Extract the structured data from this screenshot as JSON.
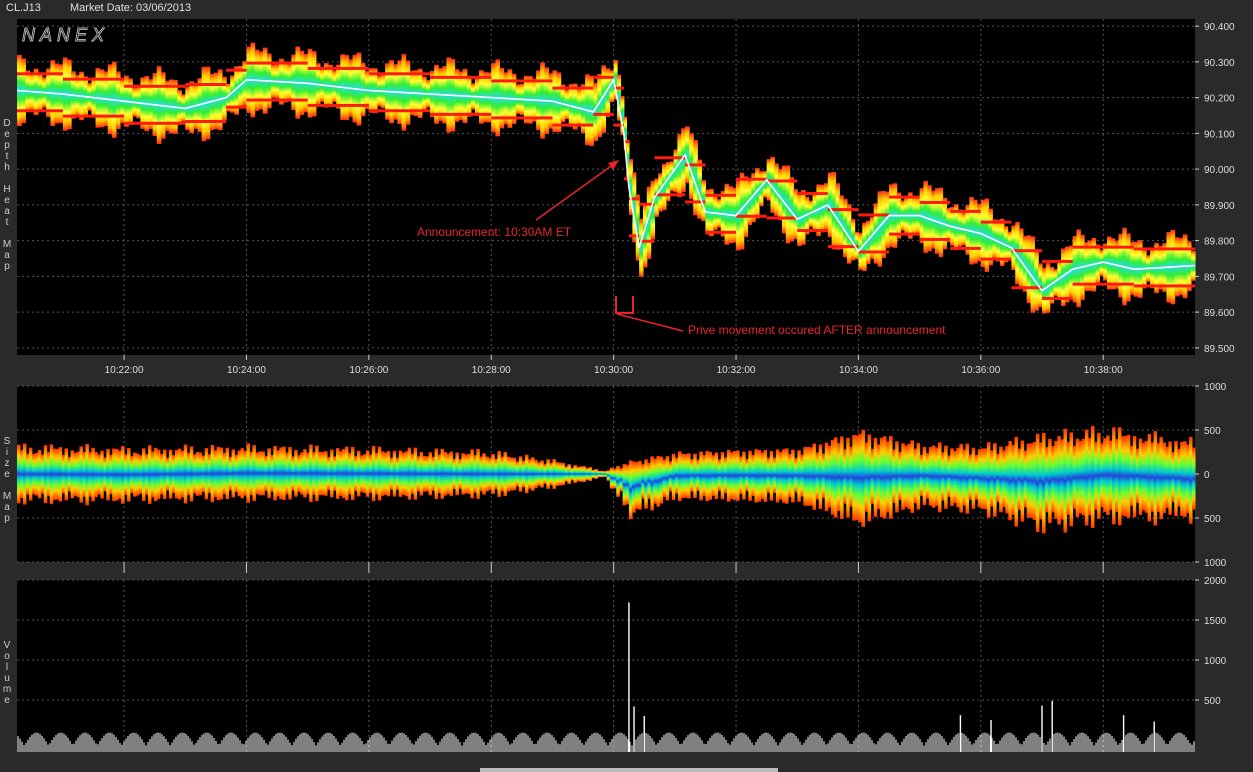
{
  "header": {
    "symbol": "CL.J13",
    "market_date": "Market Date: 03/06/2013"
  },
  "logo": {
    "text": "NANEX"
  },
  "side_labels": {
    "depth": "Depth Heat Map",
    "size": "Size Map",
    "volume": "Volume"
  },
  "annotations": {
    "announcement": "Announcement: 10:30AM ET",
    "movement": "Prive movement occured AFTER announcement"
  },
  "colors": {
    "annotation": "#e8262a",
    "grid": "#555555",
    "background": "#000000",
    "frame": "#2a2a2a"
  },
  "chart_data": [
    {
      "type": "heatmap",
      "name": "Depth Heat Map",
      "x_tick_labels": [
        "10:22:00",
        "10:24:00",
        "10:26:00",
        "10:28:00",
        "10:30:00",
        "10:32:00",
        "10:34:00",
        "10:36:00",
        "10:38:00"
      ],
      "xlim": [
        "10:20:15",
        "10:39:30"
      ],
      "y_tick_labels": [
        "90.400",
        "90.300",
        "90.200",
        "90.100",
        "90.000",
        "89.900",
        "89.800",
        "89.700",
        "89.600",
        "89.500"
      ],
      "y_ticks": [
        90.4,
        90.3,
        90.2,
        90.1,
        90.0,
        89.9,
        89.8,
        89.7,
        89.6,
        89.5
      ],
      "ylim": [
        89.48,
        90.42
      ],
      "grid": true,
      "price_path": [
        {
          "t": "10:20:15",
          "p": 90.22
        },
        {
          "t": "10:21:00",
          "p": 90.21
        },
        {
          "t": "10:22:00",
          "p": 90.19
        },
        {
          "t": "10:23:00",
          "p": 90.17
        },
        {
          "t": "10:23:40",
          "p": 90.2
        },
        {
          "t": "10:24:00",
          "p": 90.25
        },
        {
          "t": "10:25:00",
          "p": 90.24
        },
        {
          "t": "10:26:00",
          "p": 90.22
        },
        {
          "t": "10:27:00",
          "p": 90.21
        },
        {
          "t": "10:28:00",
          "p": 90.2
        },
        {
          "t": "10:29:00",
          "p": 90.19
        },
        {
          "t": "10:29:40",
          "p": 90.16
        },
        {
          "t": "10:30:00",
          "p": 90.25
        },
        {
          "t": "10:30:10",
          "p": 90.1
        },
        {
          "t": "10:30:15",
          "p": 89.95
        },
        {
          "t": "10:30:25",
          "p": 89.78
        },
        {
          "t": "10:30:40",
          "p": 89.92
        },
        {
          "t": "10:31:10",
          "p": 90.04
        },
        {
          "t": "10:31:30",
          "p": 89.88
        },
        {
          "t": "10:32:00",
          "p": 89.87
        },
        {
          "t": "10:32:30",
          "p": 89.97
        },
        {
          "t": "10:33:00",
          "p": 89.86
        },
        {
          "t": "10:33:30",
          "p": 89.9
        },
        {
          "t": "10:34:00",
          "p": 89.77
        },
        {
          "t": "10:34:30",
          "p": 89.87
        },
        {
          "t": "10:35:00",
          "p": 89.87
        },
        {
          "t": "10:35:30",
          "p": 89.84
        },
        {
          "t": "10:36:00",
          "p": 89.82
        },
        {
          "t": "10:36:30",
          "p": 89.78
        },
        {
          "t": "10:37:00",
          "p": 89.66
        },
        {
          "t": "10:37:30",
          "p": 89.72
        },
        {
          "t": "10:38:00",
          "p": 89.74
        },
        {
          "t": "10:38:30",
          "p": 89.72
        },
        {
          "t": "10:39:30",
          "p": 89.73
        }
      ]
    },
    {
      "type": "area",
      "name": "Size Map",
      "y_tick_labels": [
        "1000",
        "500",
        "0",
        "500",
        "1000"
      ],
      "y_ticks": [
        1000,
        500,
        0,
        -500,
        -1000
      ],
      "ylim": [
        -1000,
        1000
      ],
      "grid": true,
      "envelope": [
        {
          "t": "10:20:15",
          "upper": 330,
          "lower": -330
        },
        {
          "t": "10:22:00",
          "upper": 300,
          "lower": -320
        },
        {
          "t": "10:24:00",
          "upper": 320,
          "lower": -300
        },
        {
          "t": "10:26:00",
          "upper": 300,
          "lower": -290
        },
        {
          "t": "10:28:00",
          "upper": 260,
          "lower": -260
        },
        {
          "t": "10:29:00",
          "upper": 160,
          "lower": -160
        },
        {
          "t": "10:29:50",
          "upper": 40,
          "lower": -40
        },
        {
          "t": "10:30:15",
          "upper": 150,
          "lower": -500
        },
        {
          "t": "10:31:00",
          "upper": 250,
          "lower": -300
        },
        {
          "t": "10:32:00",
          "upper": 280,
          "lower": -320
        },
        {
          "t": "10:33:00",
          "upper": 300,
          "lower": -350
        },
        {
          "t": "10:34:00",
          "upper": 500,
          "lower": -600
        },
        {
          "t": "10:35:00",
          "upper": 350,
          "lower": -400
        },
        {
          "t": "10:36:00",
          "upper": 330,
          "lower": -450
        },
        {
          "t": "10:37:00",
          "upper": 450,
          "lower": -650
        },
        {
          "t": "10:38:00",
          "upper": 520,
          "lower": -550
        },
        {
          "t": "10:39:30",
          "upper": 380,
          "lower": -520
        }
      ]
    },
    {
      "type": "bar",
      "name": "Volume",
      "y_tick_labels": [
        "2000",
        "1500",
        "1000",
        "500"
      ],
      "y_ticks": [
        2000,
        1500,
        1000,
        500
      ],
      "ylim": [
        -150,
        2000
      ],
      "grid": true,
      "typical_volume": 120,
      "spikes": [
        {
          "t": "10:30:15",
          "v": 1720
        },
        {
          "t": "10:30:20",
          "v": 420
        },
        {
          "t": "10:30:30",
          "v": 300
        },
        {
          "t": "10:35:40",
          "v": 310
        },
        {
          "t": "10:36:10",
          "v": 250
        },
        {
          "t": "10:37:00",
          "v": 430
        },
        {
          "t": "10:37:10",
          "v": 490
        },
        {
          "t": "10:38:20",
          "v": 310
        },
        {
          "t": "10:38:50",
          "v": 230
        }
      ]
    }
  ]
}
